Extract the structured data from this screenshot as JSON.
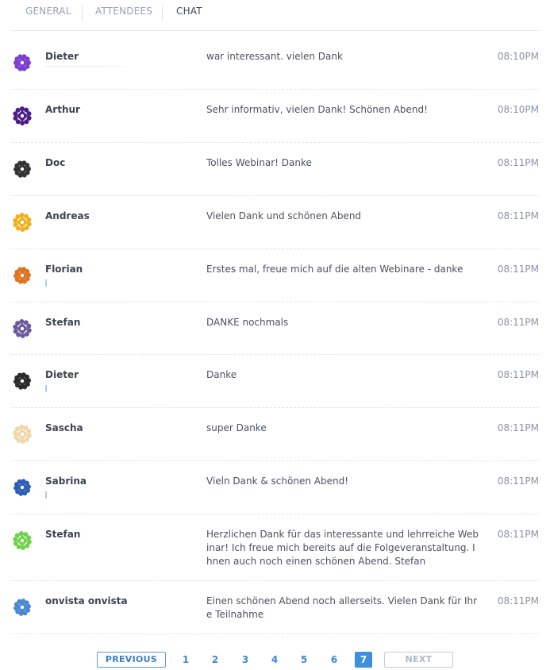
{
  "tabs": [
    {
      "label": "GENERAL"
    },
    {
      "label": "ATTENDEES"
    },
    {
      "label": "CHAT"
    }
  ],
  "messages": [
    {
      "name": "Dieter",
      "text": "war interessant. vielen Dank",
      "time": "08:10PM",
      "avatar_color": "#7a3fd0"
    },
    {
      "name": "Arthur",
      "text": "Sehr informativ, vielen Dank! Schönen Abend!",
      "time": "08:10PM",
      "avatar_color": "#4c1d86"
    },
    {
      "name": "Doc",
      "text": "Tolles Webinar! Danke",
      "time": "08:11PM",
      "avatar_color": "#333333"
    },
    {
      "name": "Andreas",
      "text": "Vielen Dank und schönen Abend",
      "time": "08:11PM",
      "avatar_color": "#f0b01e"
    },
    {
      "name": "Florian",
      "text": "Erstes mal, freue mich auf die alten Webinare - danke",
      "time": "08:11PM",
      "avatar_color": "#e07322"
    },
    {
      "name": "Stefan",
      "text": "DANKE nochmals",
      "time": "08:11PM",
      "avatar_color": "#6b5a9a"
    },
    {
      "name": "Dieter",
      "text": "Danke",
      "time": "08:11PM",
      "avatar_color": "#2b2b2b"
    },
    {
      "name": "Sascha",
      "text": "super Danke",
      "time": "08:11PM",
      "avatar_color": "#f1d6a8"
    },
    {
      "name": "Sabrina",
      "text": "Vieln Dank & schönen Abend!",
      "time": "08:11PM",
      "avatar_color": "#2d5fb8"
    },
    {
      "name": "Stefan",
      "text": "Herzlichen Dank für das interessante und lehrreiche Webinar! Ich freue mich bereits auf die Folgeveranstaltung. Ihnen auch noch einen schönen Abend. Stefan",
      "time": "08:11PM",
      "avatar_color": "#6fd34a"
    },
    {
      "name": "onvista onvista",
      "text": "Einen schönen Abend noch allerseits. Vielen Dank für Ihre Teilnahme",
      "time": "08:11PM",
      "avatar_color": "#4a86d6"
    }
  ],
  "pagination": {
    "previous_label": "PREVIOUS",
    "next_label": "NEXT",
    "pages": [
      "1",
      "2",
      "3",
      "4",
      "5",
      "6",
      "7"
    ],
    "current": "7"
  },
  "colors": {
    "accent": "#3d8fe0",
    "accent_border": "#5b9ad8"
  }
}
